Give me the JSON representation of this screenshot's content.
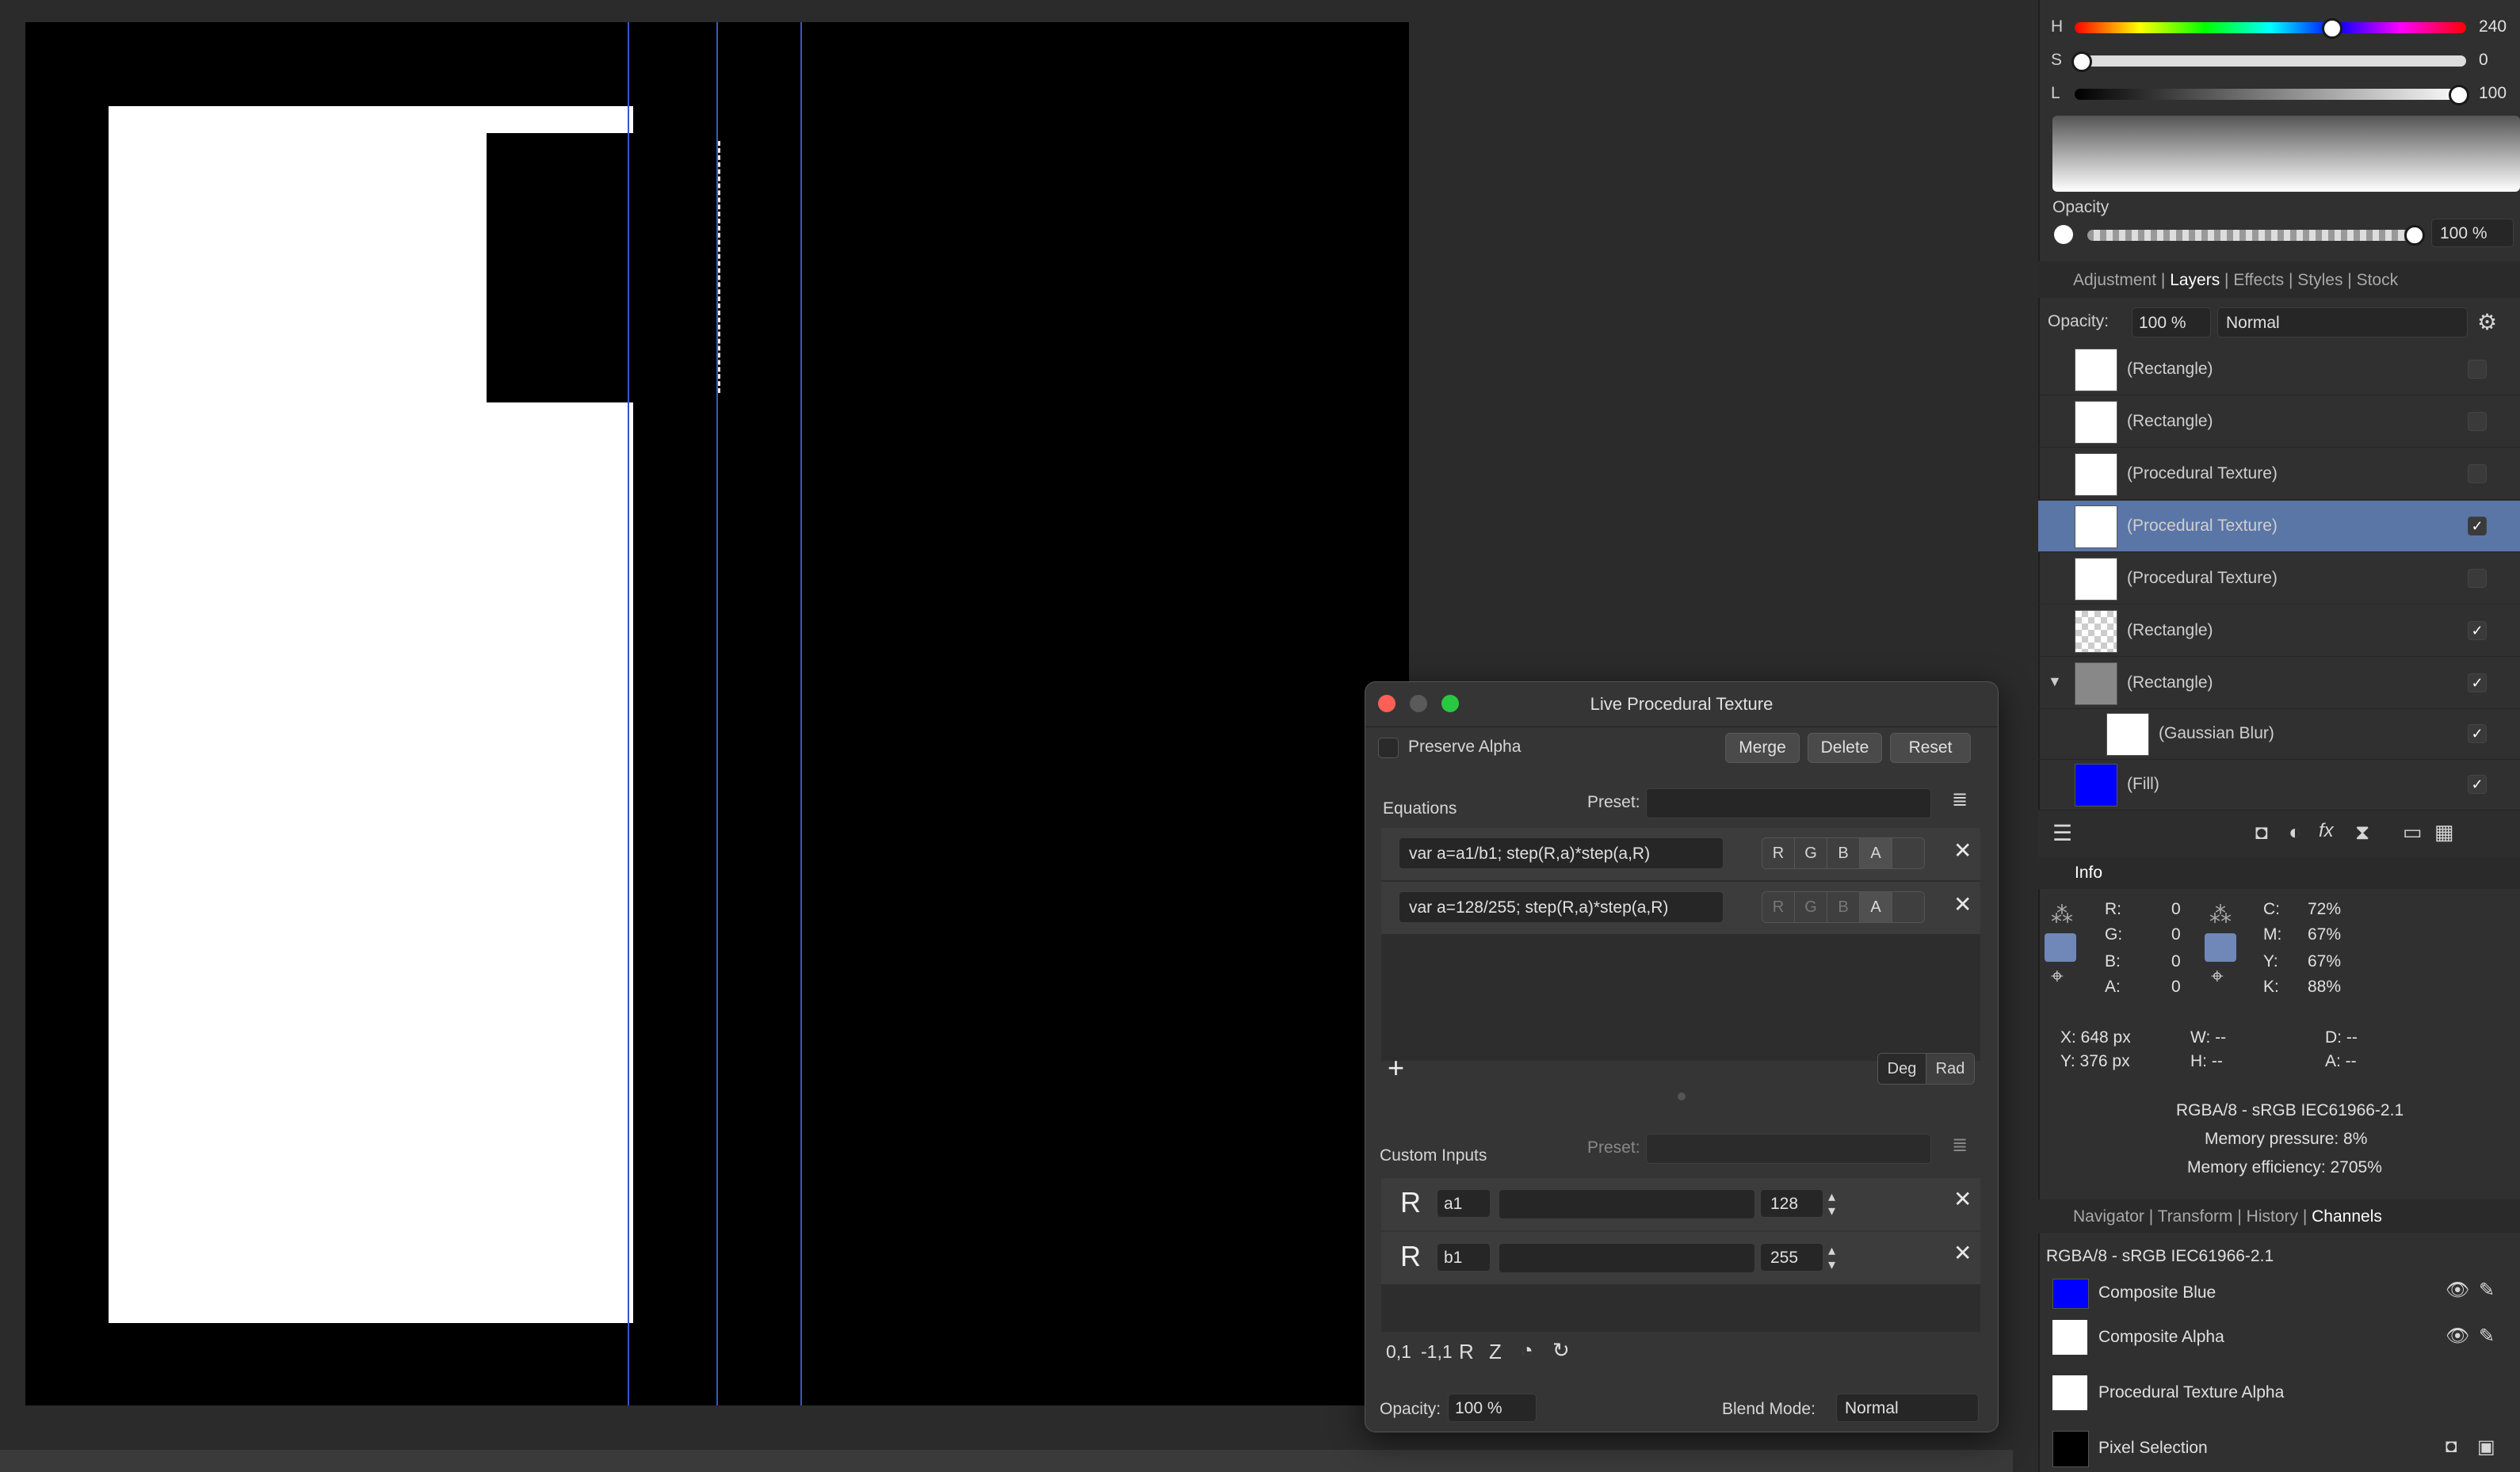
{
  "color_panel": {
    "h_label": "H",
    "h_value": "240",
    "s_label": "S",
    "s_value": "0",
    "l_label": "L",
    "l_value": "100",
    "opacity_label": "Opacity",
    "opacity_value": "100 %"
  },
  "panel_tabs_top": [
    "Adjustment",
    "Layers",
    "Effects",
    "Styles",
    "Stock"
  ],
  "layers": {
    "opacity_label": "Opacity:",
    "opacity_value": "100 %",
    "blend_mode": "Normal",
    "items": [
      {
        "name": "(Rectangle)",
        "checked": false
      },
      {
        "name": "(Rectangle)",
        "checked": false
      },
      {
        "name": "(Procedural Texture)",
        "checked": false
      },
      {
        "name": "(Procedural Texture)",
        "checked": true,
        "selected": true
      },
      {
        "name": "(Procedural Texture)",
        "checked": false
      },
      {
        "name": "(Rectangle)",
        "checked": true
      },
      {
        "name": "(Rectangle)",
        "checked": true
      },
      {
        "name": "(Gaussian Blur)",
        "checked": true
      },
      {
        "name": "(Fill)",
        "checked": true
      }
    ]
  },
  "info": {
    "tab": "Info",
    "r_label": "R:",
    "r_value": "0",
    "g_label": "G:",
    "g_value": "0",
    "b_label": "B:",
    "b_value": "0",
    "a_label": "A:",
    "a_value": "0",
    "c_label": "C:",
    "c_value": "72%",
    "m_label": "M:",
    "m_value": "67%",
    "y_label": "Y:",
    "y_value": "67%",
    "k_label": "K:",
    "k_value": "88%",
    "x_pos": "X: 648 px",
    "y_pos": "Y: 376 px",
    "w": "W: --",
    "h": "H: --",
    "d": "D: --",
    "a": "A: --",
    "format": "RGBA/8 - sRGB IEC61966-2.1",
    "memory_pressure": "Memory pressure: 8%",
    "memory_efficiency": "Memory efficiency: 2705%"
  },
  "panel_tabs_bottom": [
    "Navigator",
    "Transform",
    "History",
    "Channels"
  ],
  "channels": {
    "format": "RGBA/8 - sRGB IEC61966-2.1",
    "items": [
      "Composite Blue",
      "Composite Alpha",
      "Procedural Texture Alpha",
      "Pixel Selection"
    ]
  },
  "dialog": {
    "title": "Live Procedural Texture",
    "preserve_alpha": "Preserve Alpha",
    "merge": "Merge",
    "delete": "Delete",
    "reset": "Reset",
    "equations_label": "Equations",
    "preset_label": "Preset:",
    "equations": [
      {
        "text": "var a=a1/b1; step(R,a)*step(a,R)",
        "channels": [
          "R",
          "G",
          "B",
          "A"
        ]
      },
      {
        "text": "var a=128/255; step(R,a)*step(a,R)",
        "channels": [
          "R",
          "G",
          "B",
          "A"
        ]
      }
    ],
    "add": "+",
    "deg": "Deg",
    "rad": "Rad",
    "custom_inputs_label": "Custom Inputs",
    "custom_preset_label": "Preset:",
    "inputs": [
      {
        "type": "R",
        "name": "a1",
        "value": "128"
      },
      {
        "type": "R",
        "name": "b1",
        "value": "255"
      }
    ],
    "bottom_tools": [
      "0,1",
      "-1,1",
      "R",
      "Z"
    ],
    "opacity_label": "Opacity:",
    "opacity_value": "100 %",
    "blend_label": "Blend Mode:",
    "blend_value": "Normal"
  }
}
